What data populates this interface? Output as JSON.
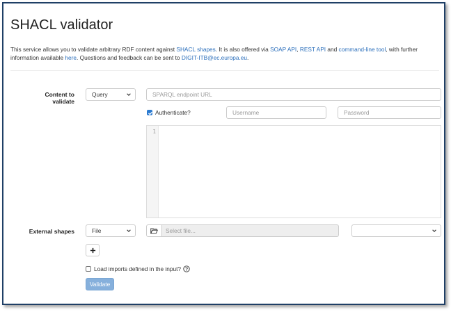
{
  "page": {
    "title": "SHACL validator",
    "intro": {
      "t1": "This service allows you to validate arbitrary RDF content against ",
      "link_shacl": "SHACL shapes",
      "t2": ". It is also offered via ",
      "link_soap": "SOAP API",
      "t3": ", ",
      "link_rest": "REST API",
      "t4": " and ",
      "link_cli": "command-line tool",
      "t5": ", with further information available ",
      "link_here": "here",
      "t6": ". Questions and feedback can be sent to ",
      "link_email": "DIGIT-ITB@ec.europa.eu",
      "t7": "."
    }
  },
  "content": {
    "label": "Content to validate",
    "type_select": "Query",
    "endpoint_placeholder": "SPARQL endpoint URL",
    "authenticate_label": "Authenticate?",
    "authenticate_checked": true,
    "username_placeholder": "Username",
    "password_placeholder": "Password",
    "editor_line_number": "1"
  },
  "shapes": {
    "label": "External shapes",
    "type_select": "File",
    "file_placeholder": "Select file...",
    "format_select": ""
  },
  "options": {
    "load_imports_label": "Load imports defined in the input?",
    "load_imports_checked": false
  },
  "actions": {
    "validate_label": "Validate"
  },
  "colors": {
    "link": "#2a6ebb",
    "validate_button": "#86b0dc",
    "frame_border": "#1f3f66"
  }
}
